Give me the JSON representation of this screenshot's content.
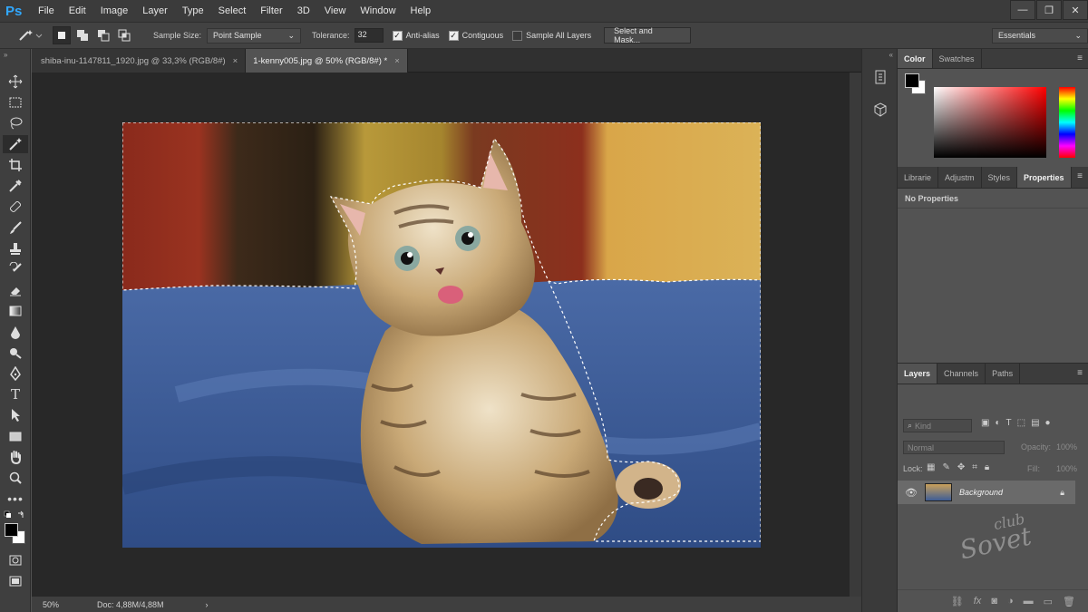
{
  "menubar": {
    "logo": "Ps",
    "items": [
      "File",
      "Edit",
      "Image",
      "Layer",
      "Type",
      "Select",
      "Filter",
      "3D",
      "View",
      "Window",
      "Help"
    ]
  },
  "options": {
    "sample_size_label": "Sample Size:",
    "sample_size_value": "Point Sample",
    "tolerance_label": "Tolerance:",
    "tolerance_value": "32",
    "anti_alias": "Anti-alias",
    "contiguous": "Contiguous",
    "sample_all_layers": "Sample All Layers",
    "select_mask": "Select and Mask...",
    "workspace": "Essentials"
  },
  "tabs": [
    {
      "label": "shiba-inu-1147811_1920.jpg @ 33,3% (RGB/8#)",
      "close": "×"
    },
    {
      "label": "1-kenny005.jpg @ 50% (RGB/8#) *",
      "close": "×"
    }
  ],
  "status": {
    "zoom": "50%",
    "doc": "Doc: 4,88M/4,88M",
    "arrow": "›"
  },
  "color_panel": {
    "tabs": [
      "Color",
      "Swatches"
    ]
  },
  "properties_panel": {
    "tabs": [
      "Librarie",
      "Adjustm",
      "Styles",
      "Properties"
    ],
    "content": "No Properties"
  },
  "layers_panel": {
    "tabs": [
      "Layers",
      "Channels",
      "Paths"
    ],
    "filter_kind": "Kind",
    "blend_mode": "Normal",
    "opacity_label": "Opacity:",
    "opacity_value": "100%",
    "lock_label": "Lock:",
    "fill_label": "Fill:",
    "fill_value": "100%",
    "layer_name": "Background"
  },
  "watermark": {
    "line1": "club",
    "line2": "Sovet"
  },
  "colors": {
    "foreground": "#000000",
    "background": "#ffffff",
    "accent": "#31a8ff"
  }
}
